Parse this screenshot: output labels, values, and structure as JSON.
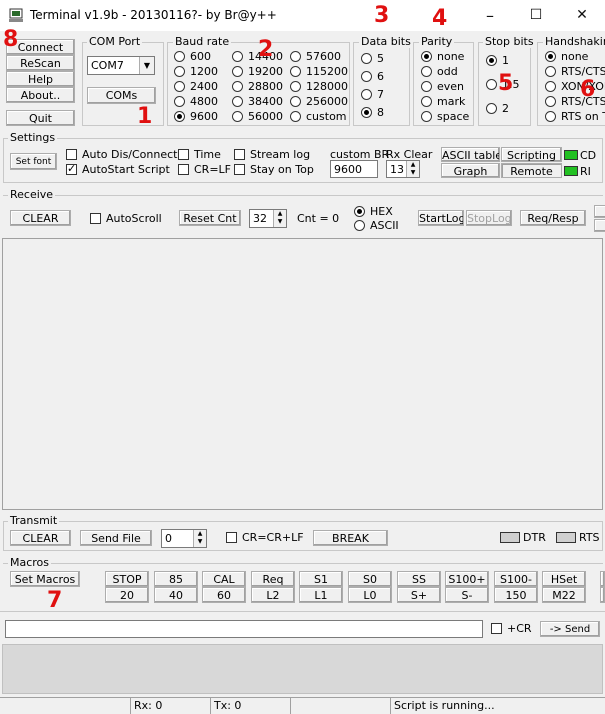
{
  "window": {
    "title": "Terminal v1.9b - 20130116?- by Br@y++",
    "min": "–",
    "max": "☐",
    "close": "✕"
  },
  "markers": [
    "1",
    "2",
    "3",
    "4",
    "5",
    "6",
    "7",
    "8"
  ],
  "left_buttons": [
    "Connect",
    "ReScan",
    "Help",
    "About..",
    "Quit"
  ],
  "com_port": {
    "label": "COM Port",
    "value": "COM7",
    "coms_button": "COMs"
  },
  "baud_rate": {
    "label": "Baud rate",
    "options": [
      "600",
      "1200",
      "2400",
      "4800",
      "9600",
      "14400",
      "19200",
      "28800",
      "38400",
      "56000",
      "57600",
      "115200",
      "128000",
      "256000",
      "custom"
    ],
    "selected": "9600"
  },
  "data_bits": {
    "label": "Data bits",
    "options": [
      "5",
      "6",
      "7",
      "8"
    ],
    "selected": "8"
  },
  "parity": {
    "label": "Parity",
    "options": [
      "none",
      "odd",
      "even",
      "mark",
      "space"
    ],
    "selected": "none"
  },
  "stop_bits": {
    "label": "Stop bits",
    "options": [
      "1",
      "1.5",
      "2"
    ],
    "selected": "1"
  },
  "handshaking": {
    "label": "Handshaking",
    "options": [
      "none",
      "RTS/CTS",
      "XON/XOFF",
      "RTS/CTS+XON/XOFF",
      "RTS on TX"
    ],
    "selected": "none"
  },
  "settings": {
    "label": "Settings",
    "set_font": "Set font",
    "auto_dis_connect": "Auto Dis/Connect",
    "autostart_script": "AutoStart Script",
    "time": "Time",
    "cr_lf": "CR=LF",
    "stream_log": "Stream log",
    "stay_on_top": "Stay on Top",
    "custom_br_label": "custom BR",
    "custom_br_value": "9600",
    "rx_clear_label": "Rx Clear",
    "rx_clear_value": "13",
    "ascii_table": "ASCII table",
    "graph": "Graph",
    "scripting": "Scripting",
    "remote": "Remote",
    "cd": "CD",
    "ri": "RI"
  },
  "receive": {
    "label": "Receive",
    "clear": "CLEAR",
    "autoscroll": "AutoScroll",
    "reset_cnt": "Reset Cnt",
    "cnt_value": "32",
    "cnt_label": "Cnt = 0",
    "hex": "HEX",
    "ascii": "ASCII",
    "startlog": "StartLog",
    "stoplog": "StopLog",
    "req_resp": "Req/Resp"
  },
  "transmit": {
    "label": "Transmit",
    "clear": "CLEAR",
    "send_file": "Send File",
    "spin_value": "0",
    "cr_crlf": "CR=CR+LF",
    "break": "BREAK",
    "dtr": "DTR",
    "rts": "RTS"
  },
  "macros": {
    "label": "Macros",
    "set_macros": "Set Macros",
    "row1": [
      "STOP",
      "85",
      "CAL",
      "Req",
      "S1",
      "S0",
      "SS",
      "S100+",
      "S100-",
      "HSet"
    ],
    "row2": [
      "20",
      "40",
      "60",
      "L2",
      "L1",
      "L0",
      "S+",
      "S-",
      "150",
      "M22"
    ]
  },
  "send": {
    "plus_cr": "+CR",
    "send_button": "-> Send"
  },
  "status": {
    "rx": "Rx: 0",
    "tx": "Tx: 0",
    "script": "Script is running..."
  },
  "colors": {
    "led_green": "#22c022",
    "marker_red": "#e01010"
  }
}
